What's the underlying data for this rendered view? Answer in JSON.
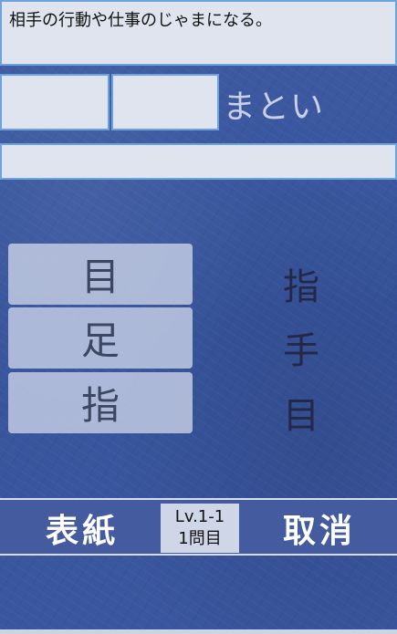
{
  "question": {
    "text": "相手の行動や仕事のじゃまになる。"
  },
  "answer": {
    "reading": "まとい",
    "slots": [
      "",
      ""
    ],
    "current": ""
  },
  "choices": [
    {
      "label": "目"
    },
    {
      "label": "足"
    },
    {
      "label": "指"
    }
  ],
  "hints": [
    "指",
    "手",
    "目"
  ],
  "footer": {
    "cover_label": "表紙",
    "undo_label": "取消",
    "level": "Lv.1-1",
    "question_number": "1問目"
  }
}
